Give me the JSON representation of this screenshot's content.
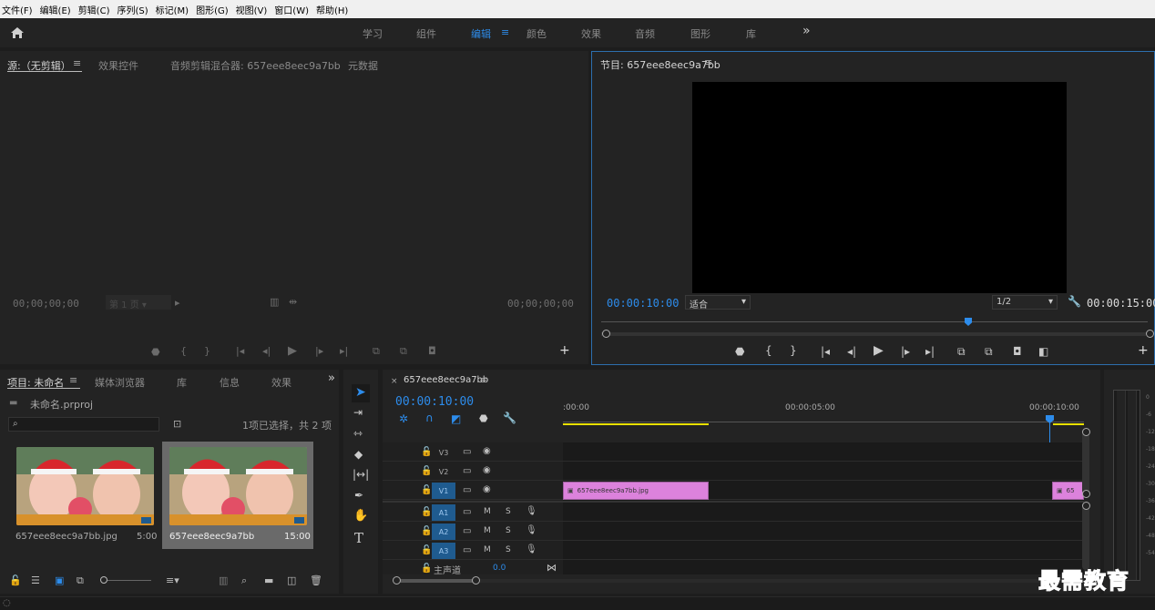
{
  "menu": [
    "文件(F)",
    "编辑(E)",
    "剪辑(C)",
    "序列(S)",
    "标记(M)",
    "图形(G)",
    "视图(V)",
    "窗口(W)",
    "帮助(H)"
  ],
  "workspaces": [
    "学习",
    "组件",
    "编辑",
    "颜色",
    "效果",
    "音频",
    "图形",
    "库"
  ],
  "workspace_active": "编辑",
  "more_glyph": "»",
  "source": {
    "tabs": [
      "源:（无剪辑）",
      "效果控件",
      "音频剪辑混合器: 657eee8eec9a7bb",
      "元数据"
    ],
    "timecode_left": "00;00;00;00",
    "timecode_right": "00;00;00;00",
    "page_select": "第 1 页"
  },
  "program": {
    "title": "节目: 657eee8eec9a7bb",
    "timecode": "00:00:10:00",
    "fit": "适合",
    "resolution": "1/2",
    "duration": "00:00:15:00"
  },
  "project": {
    "tabs": [
      "项目: 未命名",
      "媒体浏览器",
      "库",
      "信息",
      "效果"
    ],
    "file": "未命名.prproj",
    "selection": "1项已选择，共 2 项",
    "items": [
      {
        "name": "657eee8eec9a7bb.jpg",
        "duration": "5:00"
      },
      {
        "name": "657eee8eec9a7bb",
        "duration": "15:00"
      }
    ]
  },
  "timeline": {
    "tab": "657eee8eec9a7bb",
    "timecode": "00:00:10:00",
    "ruler": [
      ":00:00",
      "00:00:05:00",
      "00:00:10:00"
    ],
    "video_tracks": [
      "V3",
      "V2",
      "V1"
    ],
    "audio_tracks": [
      "A1",
      "A2",
      "A3"
    ],
    "master_label": "主声道",
    "master_value": "0.0",
    "clip1": "657eee8eec9a7bb.jpg",
    "clip2": "65",
    "m_label": "M",
    "s_label": "S"
  },
  "meter": [
    "0",
    "-6",
    "-12",
    "-18",
    "-24",
    "-30",
    "-36",
    "-42",
    "-48",
    "-54"
  ],
  "watermark": "最需教育",
  "colors": {
    "accent": "#2d8ceb",
    "clip": "#dc82dc",
    "inout": "#e8e000",
    "panel": "#232323",
    "bg": "#1d1d1d"
  }
}
